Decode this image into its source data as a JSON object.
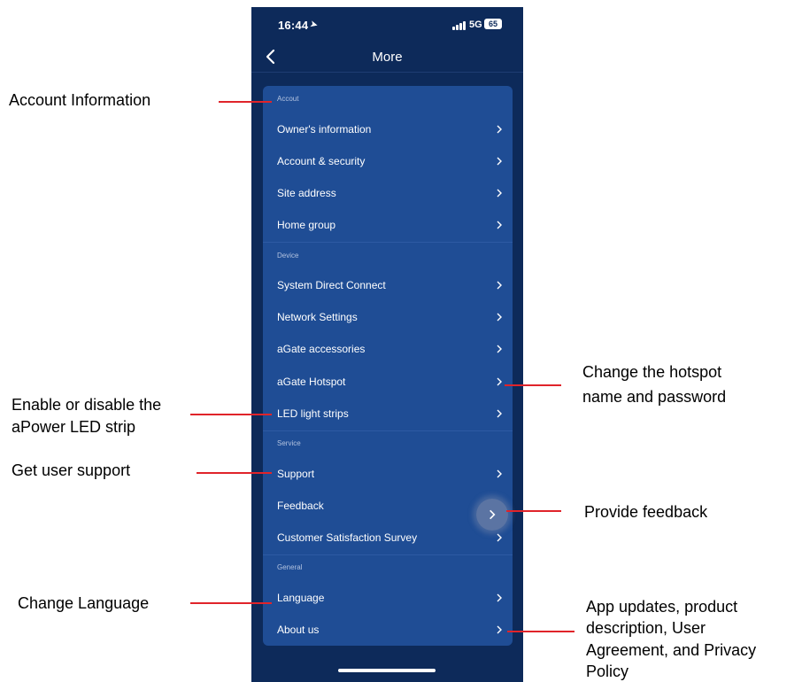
{
  "status_bar": {
    "time": "16:44",
    "network": "5G",
    "battery": "65"
  },
  "nav": {
    "title": "More"
  },
  "sections": [
    {
      "title": "Accout",
      "items": [
        "Owner's information",
        "Account & security",
        "Site address",
        "Home group"
      ]
    },
    {
      "title": "Device",
      "items": [
        "System Direct Connect",
        "Network Settings",
        "aGate accessories",
        "aGate Hotspot",
        "LED light strips"
      ]
    },
    {
      "title": "Service",
      "items": [
        "Support",
        "Feedback",
        "Customer Satisfaction Survey"
      ]
    },
    {
      "title": "General",
      "items": [
        "Language",
        "About us"
      ]
    }
  ],
  "annotations": {
    "account_info": "Account Information",
    "led_line1": "Enable or disable the",
    "led_line2": "aPower LED strip",
    "support": "Get user support",
    "language": "Change Language",
    "hotspot_line1": "Change the hotspot",
    "hotspot_line2": "name and password",
    "feedback": "Provide feedback",
    "about_line1": "App updates, product",
    "about_line2": "description, User",
    "about_line3": "Agreement, and Privacy",
    "about_line4": "Policy"
  },
  "colors": {
    "background": "#0d2a5a",
    "card": "#1f4d95",
    "annotation_line": "#e0242a"
  }
}
